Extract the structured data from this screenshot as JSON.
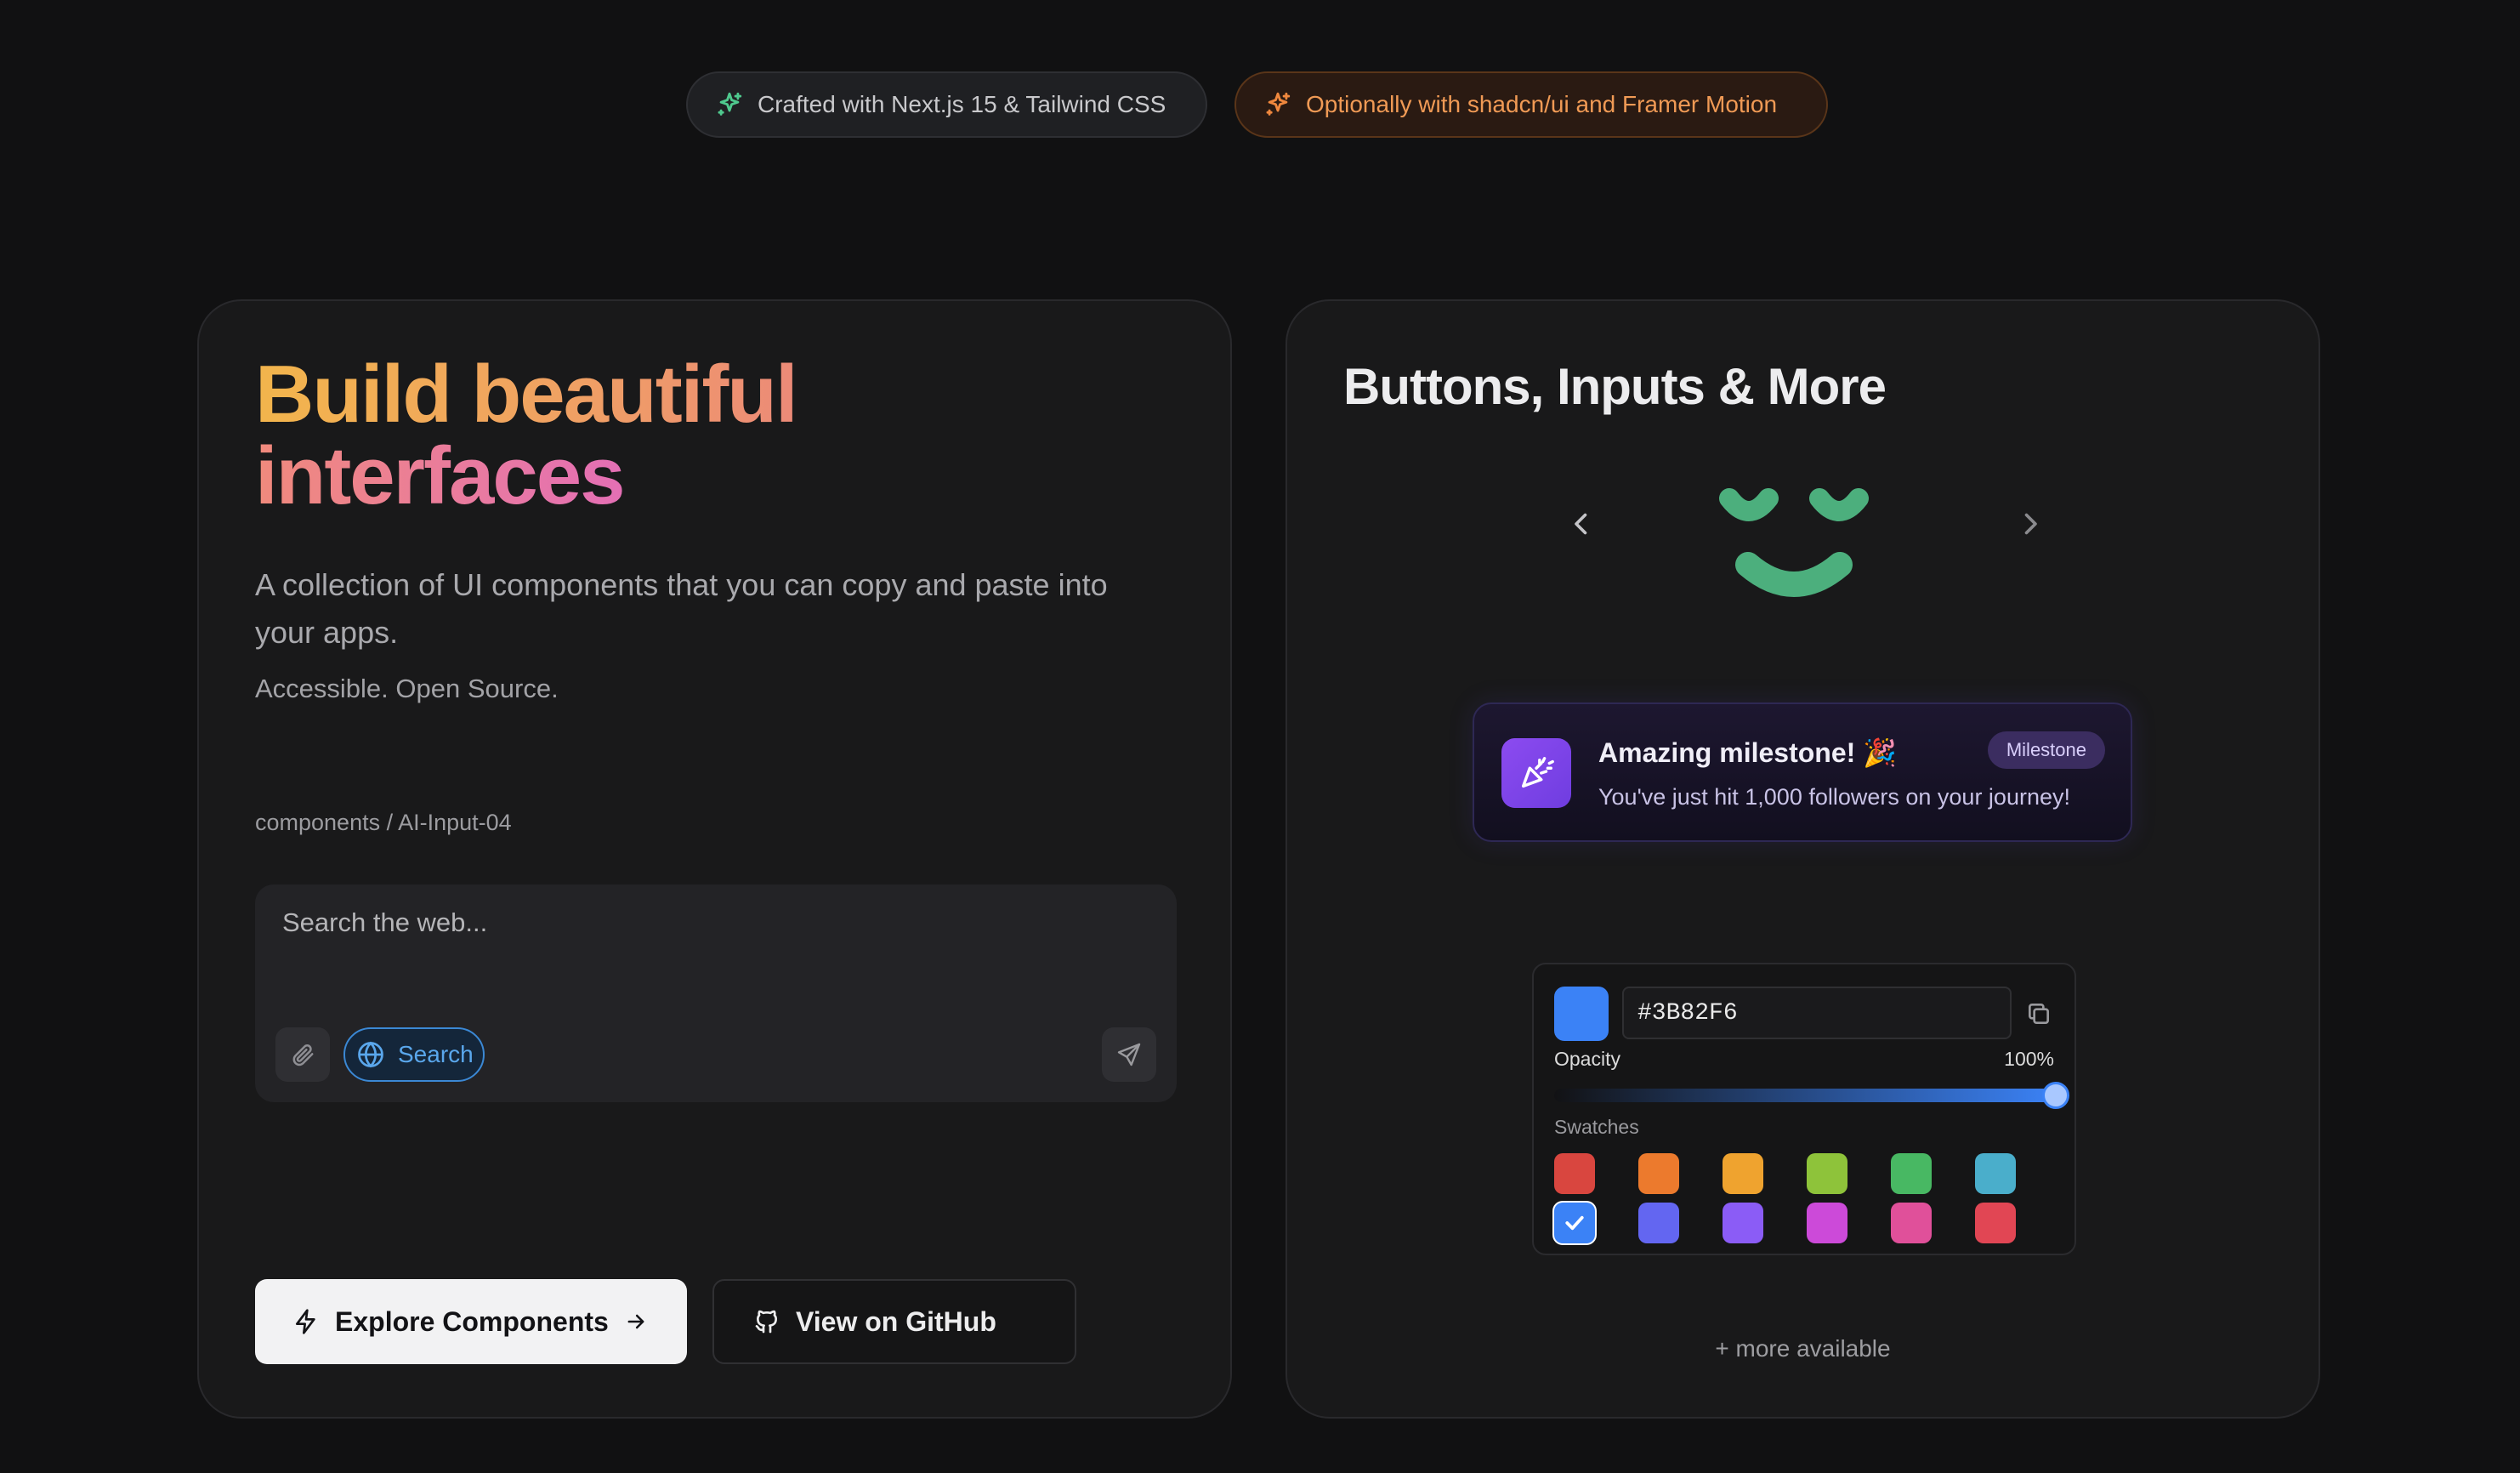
{
  "badges": [
    {
      "label": "Crafted with Next.js 15 & Tailwind CSS",
      "color": "#4fc98e"
    },
    {
      "label": "Optionally with shadcn/ui and Framer Motion",
      "color": "#f0883e"
    }
  ],
  "hero": {
    "title_line1": "Build beautiful",
    "title_line2": "interfaces",
    "description": "A collection of UI components that you can copy and paste into your apps.",
    "subtext": "Accessible. Open Source.",
    "breadcrumb": "components / AI-Input-04"
  },
  "ai_input": {
    "placeholder": "Search the web...",
    "search_label": "Search"
  },
  "actions": {
    "explore_label": "Explore Components",
    "github_label": "View on GitHub"
  },
  "showcase": {
    "title": "Buttons, Inputs & More",
    "smiley_color": "#4caf7d",
    "toast": {
      "title": "Amazing milestone! 🎉",
      "badge": "Milestone",
      "message": "You've just hit 1,000 followers on your journey!"
    },
    "color_picker": {
      "hex": "#3B82F6",
      "opacity_label": "Opacity",
      "opacity_value": "100%",
      "opacity_fraction": 1.0,
      "swatches_label": "Swatches",
      "swatches": [
        "#d9463f",
        "#ec7a2d",
        "#efa32f",
        "#8ec33a",
        "#48b863",
        "#4aaecb",
        "#3b82f6",
        "#6366f1",
        "#8b5cf6",
        "#cc4ad9",
        "#e0509a",
        "#e14654"
      ],
      "selected_index": 6
    },
    "more_text": "+ more available"
  }
}
